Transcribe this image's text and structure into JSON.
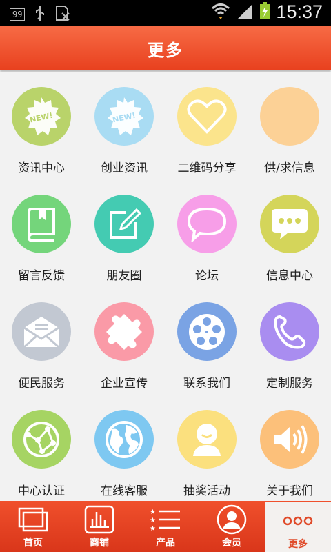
{
  "status_bar": {
    "notification_badge": "99",
    "time": "15:37"
  },
  "header": {
    "title": "更多"
  },
  "grid": {
    "items": [
      {
        "label": "资讯中心",
        "icon": "new-badge-icon",
        "color": "#b9d36a",
        "badge_text": "NEW!"
      },
      {
        "label": "创业资讯",
        "icon": "new-badge-icon",
        "color": "#a9dcf3",
        "badge_text": "NEW!"
      },
      {
        "label": "二维码分享",
        "icon": "heart-icon",
        "color": "#fbe48c"
      },
      {
        "label": "供/求信息",
        "icon": "blank-icon",
        "color": "#fcd196"
      },
      {
        "label": "留言反馈",
        "icon": "book-icon",
        "color": "#74d57b"
      },
      {
        "label": "朋友圈",
        "icon": "edit-icon",
        "color": "#44cbb2"
      },
      {
        "label": "论坛",
        "icon": "speech-bubble-icon",
        "color": "#f79ee8"
      },
      {
        "label": "信息中心",
        "icon": "chat-icon",
        "color": "#d4d55a"
      },
      {
        "label": "便民服务",
        "icon": "mail-icon",
        "color": "#c2c8d2"
      },
      {
        "label": "企业宣传",
        "icon": "puzzle-icon",
        "color": "#fa9aa7"
      },
      {
        "label": "联系我们",
        "icon": "film-reel-icon",
        "color": "#7aa3e4"
      },
      {
        "label": "定制服务",
        "icon": "phone-icon",
        "color": "#a98df0"
      },
      {
        "label": "中心认证",
        "icon": "network-globe-icon",
        "color": "#a6d463"
      },
      {
        "label": "在线客服",
        "icon": "globe-icon",
        "color": "#7ec8f1"
      },
      {
        "label": "抽奖活动",
        "icon": "user-icon",
        "color": "#fbe07e"
      },
      {
        "label": "关于我们",
        "icon": "speaker-icon",
        "color": "#fcc07a"
      }
    ]
  },
  "tabbar": {
    "tabs": [
      {
        "label": "首页",
        "icon": "home-icon"
      },
      {
        "label": "商铺",
        "icon": "shop-icon"
      },
      {
        "label": "产品",
        "icon": "list-icon"
      },
      {
        "label": "会员",
        "icon": "member-icon"
      },
      {
        "label": "更多",
        "icon": "more-icon",
        "active": true
      }
    ]
  }
}
